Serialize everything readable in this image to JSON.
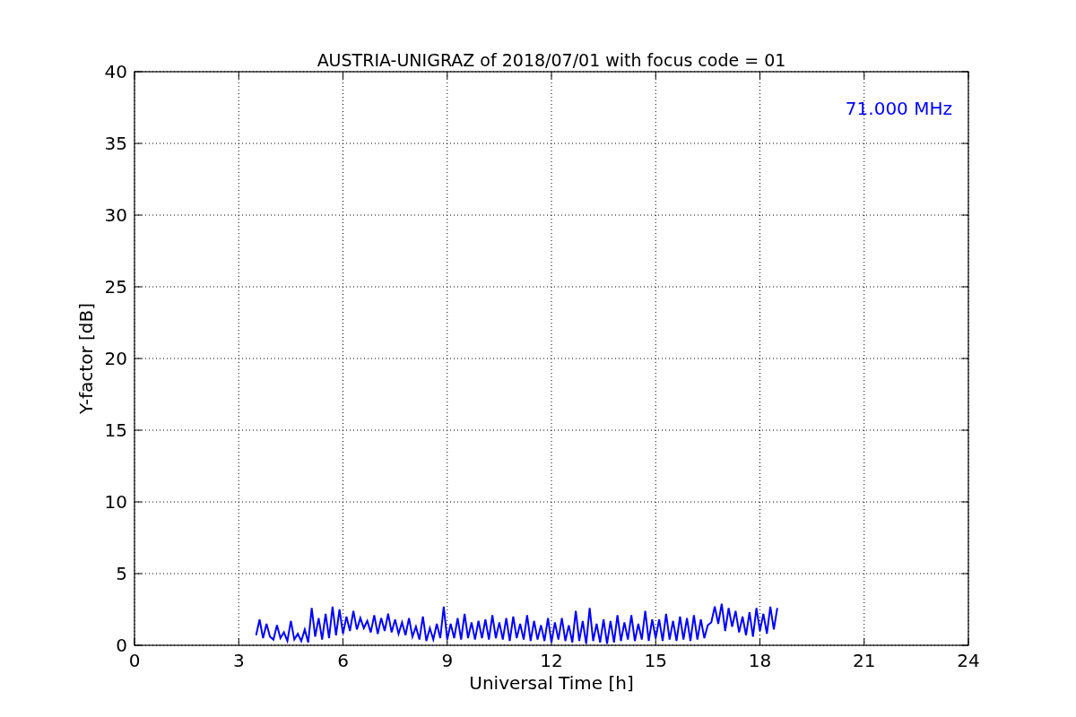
{
  "figure": {
    "chart_data": {
      "type": "line",
      "title": "AUSTRIA-UNIGRAZ of 2018/07/01 with focus code = 01",
      "xlabel": "Universal Time [h]",
      "ylabel": "Y-factor [dB]",
      "xlim": [
        0,
        24
      ],
      "ylim": [
        0,
        40
      ],
      "xticks": [
        0,
        3,
        6,
        9,
        12,
        15,
        18,
        21,
        24
      ],
      "yticks": [
        0,
        5,
        10,
        15,
        20,
        25,
        30,
        35,
        40
      ],
      "x": [
        3.5,
        3.6,
        3.7,
        3.8,
        3.9,
        4.0,
        4.1,
        4.2,
        4.3,
        4.4,
        4.5,
        4.6,
        4.7,
        4.8,
        4.9,
        5.0,
        5.1,
        5.2,
        5.3,
        5.4,
        5.5,
        5.6,
        5.7,
        5.8,
        5.9,
        6.0,
        6.1,
        6.2,
        6.3,
        6.4,
        6.5,
        6.6,
        6.7,
        6.8,
        6.9,
        7.0,
        7.1,
        7.2,
        7.3,
        7.4,
        7.5,
        7.6,
        7.7,
        7.8,
        7.9,
        8.0,
        8.1,
        8.2,
        8.3,
        8.4,
        8.5,
        8.6,
        8.7,
        8.8,
        8.9,
        9.0,
        9.1,
        9.2,
        9.3,
        9.4,
        9.5,
        9.6,
        9.7,
        9.8,
        9.9,
        10.0,
        10.1,
        10.2,
        10.3,
        10.4,
        10.5,
        10.6,
        10.7,
        10.8,
        10.9,
        11.0,
        11.1,
        11.2,
        11.3,
        11.4,
        11.5,
        11.6,
        11.7,
        11.8,
        11.9,
        12.0,
        12.1,
        12.2,
        12.3,
        12.4,
        12.5,
        12.6,
        12.7,
        12.8,
        12.9,
        13.0,
        13.1,
        13.2,
        13.3,
        13.4,
        13.5,
        13.6,
        13.7,
        13.8,
        13.9,
        14.0,
        14.1,
        14.2,
        14.3,
        14.4,
        14.5,
        14.6,
        14.7,
        14.8,
        14.9,
        15.0,
        15.1,
        15.2,
        15.3,
        15.4,
        15.5,
        15.6,
        15.7,
        15.8,
        15.9,
        16.0,
        16.1,
        16.2,
        16.3,
        16.4,
        16.5,
        16.6,
        16.7,
        16.8,
        16.9,
        17.0,
        17.1,
        17.2,
        17.3,
        17.4,
        17.5,
        17.6,
        17.7,
        17.8,
        17.9,
        18.0,
        18.1,
        18.2,
        18.3,
        18.4,
        18.5
      ],
      "series": [
        {
          "name": "71.000 MHz",
          "color": "#0000ff",
          "values": [
            0.7,
            1.8,
            0.5,
            1.5,
            0.6,
            0.4,
            1.4,
            0.5,
            0.9,
            0.3,
            1.7,
            0.4,
            0.8,
            0.3,
            1.1,
            0.2,
            2.6,
            0.6,
            1.9,
            0.4,
            2.2,
            0.5,
            2.7,
            0.7,
            2.5,
            0.8,
            2.0,
            1.0,
            2.4,
            1.1,
            1.9,
            1.2,
            1.7,
            0.9,
            2.1,
            0.8,
            1.9,
            1.0,
            2.2,
            0.9,
            1.8,
            0.8,
            1.6,
            0.7,
            1.9,
            0.6,
            1.3,
            0.4,
            2.0,
            0.3,
            1.2,
            0.4,
            1.5,
            0.5,
            2.7,
            0.4,
            1.5,
            0.5,
            1.9,
            0.4,
            2.2,
            0.5,
            1.6,
            0.4,
            1.7,
            0.5,
            1.8,
            0.4,
            2.1,
            0.5,
            1.6,
            0.4,
            1.9,
            0.3,
            2.0,
            0.5,
            1.5,
            0.4,
            2.1,
            0.3,
            1.7,
            0.4,
            1.4,
            0.3,
            1.9,
            0.2,
            1.6,
            0.4,
            1.9,
            0.3,
            1.4,
            0.2,
            2.4,
            0.3,
            1.7,
            0.1,
            2.6,
            0.3,
            1.5,
            0.2,
            1.8,
            0.1,
            1.7,
            0.2,
            2.1,
            0.3,
            1.6,
            0.4,
            2.1,
            0.3,
            1.5,
            0.4,
            2.4,
            0.3,
            1.8,
            0.5,
            1.8,
            0.3,
            2.2,
            0.4,
            1.7,
            0.3,
            2.0,
            0.4,
            1.9,
            0.3,
            2.1,
            0.4,
            1.8,
            0.5,
            1.4,
            1.6,
            2.7,
            1.5,
            2.9,
            1.0,
            2.6,
            1.3,
            2.4,
            0.9,
            2.0,
            0.7,
            2.3,
            0.6,
            2.6,
            1.0,
            2.2,
            0.8,
            2.7,
            1.1,
            2.6
          ]
        }
      ],
      "grid": true
    }
  }
}
